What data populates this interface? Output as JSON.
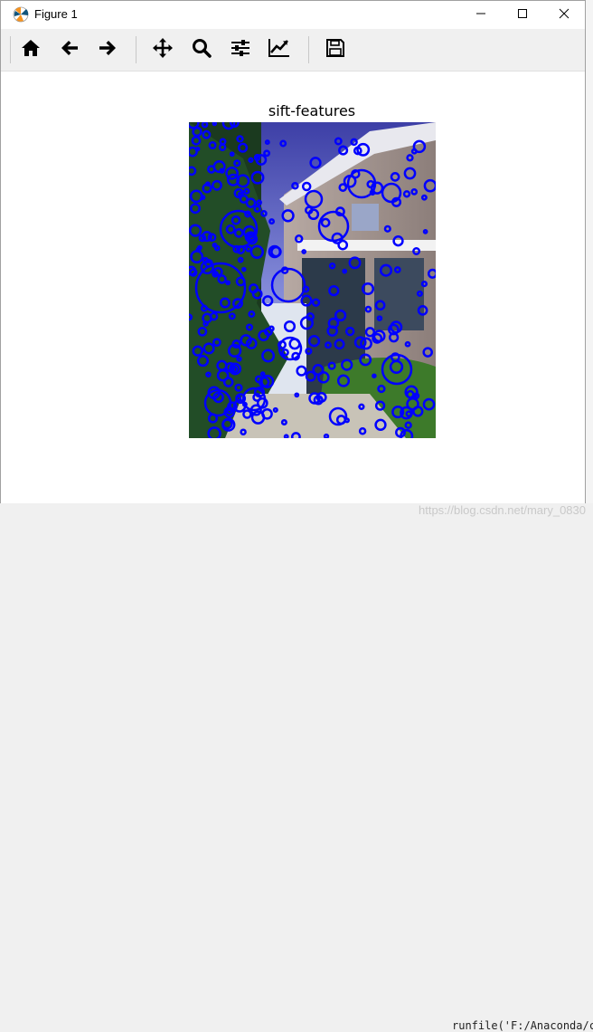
{
  "window": {
    "title": "Figure 1",
    "icon": "matplotlib-icon",
    "controls": [
      "minimize-icon",
      "maximize-icon",
      "close-icon"
    ]
  },
  "toolbar": {
    "buttons": [
      "home-icon",
      "back-arrow-icon",
      "forward-arrow-icon",
      "pan-move-icon",
      "zoom-magnifier-icon",
      "configure-subplots-icon",
      "edit-axes-icon",
      "save-floppy-icon"
    ]
  },
  "figure": {
    "title": "sift-features",
    "image_description_icon": "photo-of-house-with-sift-keypoints",
    "keypoint_color": "#0000ff"
  },
  "watermark": "https://blog.csdn.net/mary_0830",
  "background_editor": {
    "bottom_text": "runfile('F:/Anaconda/c"
  }
}
